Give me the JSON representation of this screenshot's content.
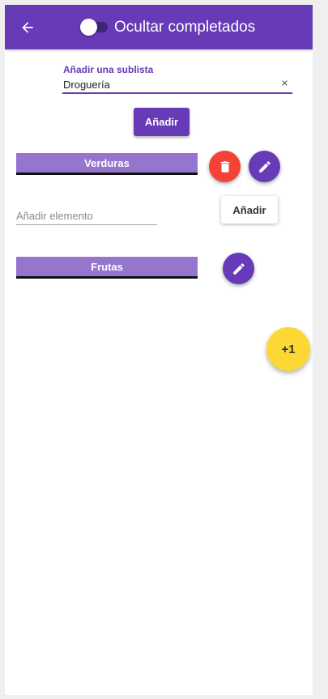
{
  "appbar": {
    "title": "Ocultar completados",
    "back_icon": "arrow-left-icon",
    "toggle_on": false,
    "background": "#673ab7"
  },
  "sublist_form": {
    "label": "Añadir una sublista",
    "value": "Droguería",
    "clear_icon": "close-icon",
    "add_label": "Añadir"
  },
  "sublists": [
    {
      "name": "Verduras",
      "actions": [
        "delete-icon",
        "pencil-icon"
      ]
    },
    {
      "name": "Frutas",
      "actions": [
        "pencil-icon"
      ]
    }
  ],
  "item_form": {
    "placeholder": "Añadir elemento",
    "add_label": "Añadir"
  },
  "fab": {
    "label": "+1",
    "color": "#fdd835"
  },
  "colors": {
    "primary": "#673ab7",
    "sublist_bar": "#9575cd",
    "danger": "#f44336"
  }
}
